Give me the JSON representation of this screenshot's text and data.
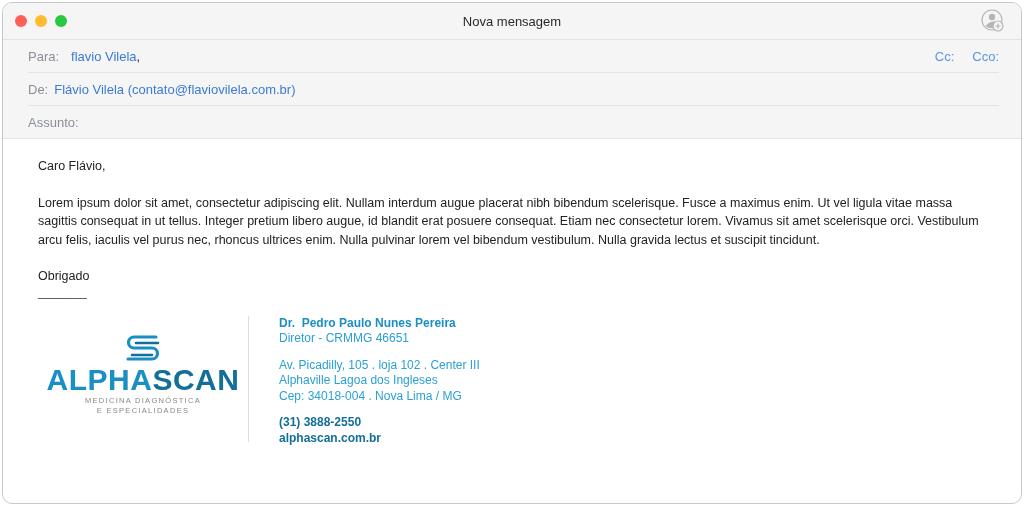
{
  "window": {
    "title": "Nova mensagem"
  },
  "header": {
    "to_label": "Para:",
    "to_value": "flavio Vilela",
    "to_separator": ",",
    "cc": "Cc:",
    "bcc": "Cco:",
    "from_label": "De:",
    "from_value": "Flávio Vilela (contato@flaviovilela.com.br)",
    "subject_label": "Assunto:"
  },
  "body": {
    "greeting": "Caro Flávio,",
    "paragraph": "Lorem ipsum dolor sit amet, consectetur adipiscing elit. Nullam interdum augue placerat nibh bibendum scelerisque. Fusce a maximus enim. Ut vel ligula vitae massa sagittis consequat in ut tellus. Integer pretium libero augue, id blandit erat posuere consequat. Etiam nec consectetur lorem. Vivamus sit amet scelerisque orci. Vestibulum arcu felis, iaculis vel purus nec, rhoncus ultrices enim. Nulla pulvinar lorem vel bibendum vestibulum. Nulla gravida lectus et suscipit tincidunt.",
    "closing": "Obrigado",
    "rule": "_______"
  },
  "signature": {
    "logo_name": [
      "ALPHA",
      "SCAN"
    ],
    "logo_tagline": [
      "MEDICINA DIAGNÓSTICA",
      "E ESPECIALIDADES"
    ],
    "name": "Dr.  Pedro Paulo Nunes Pereira",
    "role": "Diretor - CRMMG 46651",
    "address": [
      "Av. Picadilly, 105 . loja 102 . Center III",
      "Alphaville Lagoa dos Ingleses",
      "Cep: 34018-004 . Nova Lima / MG"
    ],
    "phone": "(31) 3888-2550",
    "website": "alphascan.com.br"
  }
}
